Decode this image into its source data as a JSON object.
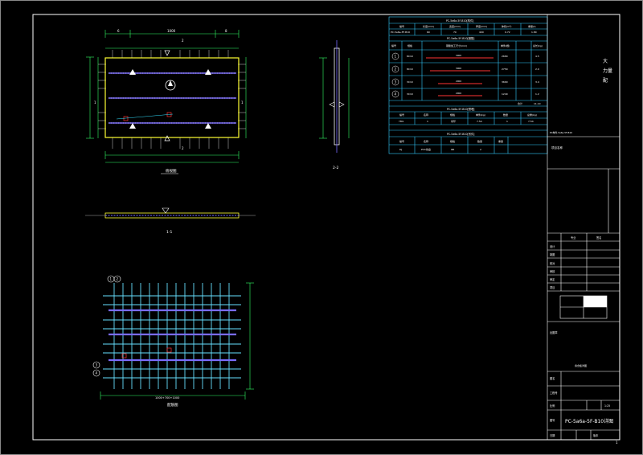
{
  "colors": {
    "background": "#000000",
    "frame": "#ffffff",
    "table": "#33ccff",
    "panel_edge": "#ffff33",
    "rebar_main": "#7a6cff",
    "rebar_grid": "#66e0ff",
    "dimension": "#33ff66",
    "highlight": "#ff3333"
  },
  "plan": {
    "dim_top": [
      "6",
      "1000",
      "8"
    ],
    "section_marks": [
      "1",
      "1"
    ],
    "section_marks_side": [
      "2",
      "2"
    ],
    "caption": "俯视图"
  },
  "section_1": {
    "caption": "1-1"
  },
  "section_2": {
    "caption": "2-2"
  },
  "rebar_view": {
    "caption": "配筋图",
    "bubbles": [
      "1",
      "2",
      "3",
      "4"
    ],
    "dim_bottom": "1000+700+1000"
  },
  "schedule": {
    "title_1": "PC-5a6a-5F-B10[构件]",
    "header_1": [
      "编号",
      "长度(mm)",
      "宽度(mm)",
      "厚度(mm)",
      "体积(m³)",
      "重量(t)"
    ],
    "row_1": [
      "PC-5a6a-5F-B10",
      "60",
      "70",
      "400",
      "0.72",
      "1.80"
    ],
    "title_2": "PC-5a6a-5F-B10[钢筋]",
    "header_2": [
      "编号",
      "规格",
      "钢筋加工尺寸(mm)",
      "单件(根)",
      "总长(kg)"
    ],
    "rebar_rows": [
      {
        "id": "1",
        "spec": "8C10",
        "len": "3000",
        "count": "2680",
        "wt": "4.5"
      },
      {
        "id": "2",
        "spec": "8C10",
        "len": "3000",
        "count": "2750",
        "wt": "2.0"
      },
      {
        "id": "3",
        "spec": "3C10",
        "len": "2000",
        "count": "3660",
        "wt": "3.4"
      },
      {
        "id": "4",
        "spec": "3C10",
        "len": "2000",
        "count": "1240",
        "wt": "1.2"
      }
    ],
    "total_label": "合计",
    "total_value": "11.10",
    "title_3": "PC-5a6a-5F-B10[预埋]",
    "header_3": [
      "编号",
      "名称",
      "规格",
      "单件(kg)",
      "数量",
      "总重(kg)"
    ],
    "row_3": [
      "YM1",
      "1",
      "吊环",
      "7.54",
      "1",
      "7.54"
    ],
    "title_4": "PC-5a6a-5F-B10[吊件]",
    "header_4": [
      "编号",
      "名称",
      "规格",
      "数量",
      "重量"
    ],
    "row_4": [
      "DJ",
      "PVC线盒",
      "Φ6",
      "2",
      ""
    ]
  },
  "title_block": {
    "top_note_1": "大",
    "top_note_2": "力量",
    "top_note_3": "配",
    "small_note": "PC构件-5a6a-5F-B10",
    "project_label": "项目名称",
    "rows_label": [
      "设计",
      "制图",
      "校对",
      "审核",
      "审定",
      "项目",
      "专业"
    ],
    "col_a": "专业",
    "col_b": "签名",
    "stamp_label": "出图章",
    "drawing_label": "图纸名称",
    "drawing_title": "叠合板详图",
    "rows_bottom": [
      "图名",
      "工程号",
      "比例",
      "图号"
    ],
    "scale": "1:25",
    "drawing_no": "PC-5a6a-5F-B10详图",
    "date_label": "日期",
    "version_label": "版本",
    "page_mark": "1"
  }
}
